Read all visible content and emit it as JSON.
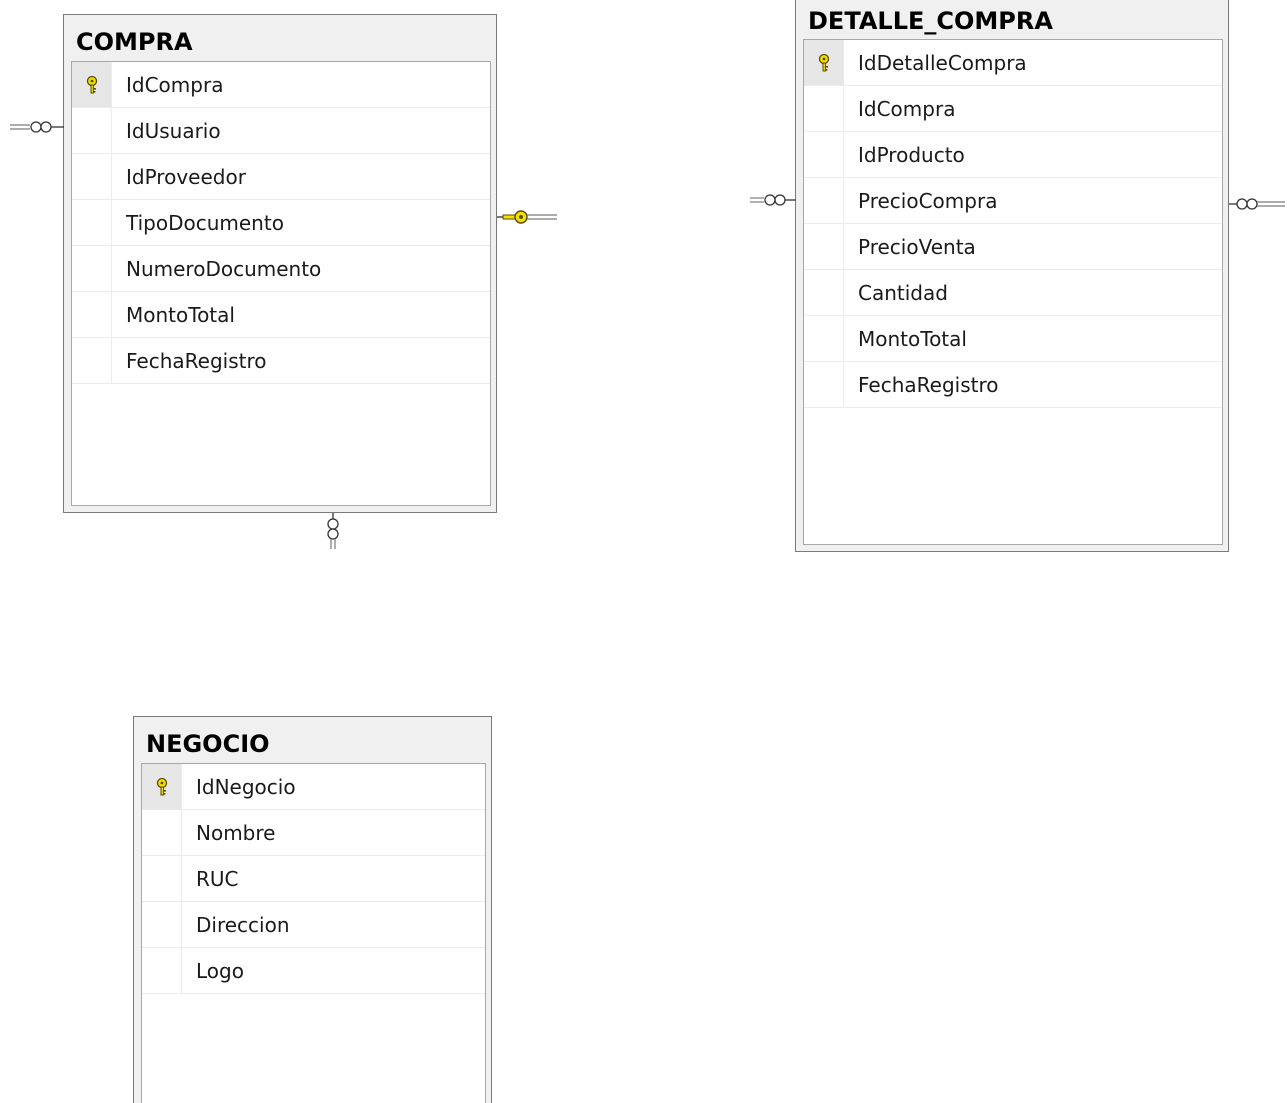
{
  "tables": [
    {
      "name": "COMPRA",
      "columns": [
        {
          "label": "IdCompra",
          "pk": true
        },
        {
          "label": "IdUsuario",
          "pk": false
        },
        {
          "label": "IdProveedor",
          "pk": false
        },
        {
          "label": "TipoDocumento",
          "pk": false
        },
        {
          "label": "NumeroDocumento",
          "pk": false
        },
        {
          "label": "MontoTotal",
          "pk": false
        },
        {
          "label": "FechaRegistro",
          "pk": false
        }
      ]
    },
    {
      "name": "DETALLE_COMPRA",
      "columns": [
        {
          "label": "IdDetalleCompra",
          "pk": true
        },
        {
          "label": "IdCompra",
          "pk": false
        },
        {
          "label": "IdProducto",
          "pk": false
        },
        {
          "label": "PrecioCompra",
          "pk": false
        },
        {
          "label": "PrecioVenta",
          "pk": false
        },
        {
          "label": "Cantidad",
          "pk": false
        },
        {
          "label": "MontoTotal",
          "pk": false
        },
        {
          "label": "FechaRegistro",
          "pk": false
        }
      ]
    },
    {
      "name": "NEGOCIO",
      "columns": [
        {
          "label": "IdNegocio",
          "pk": true
        },
        {
          "label": "Nombre",
          "pk": false
        },
        {
          "label": "RUC",
          "pk": false
        },
        {
          "label": "Direccion",
          "pk": false
        },
        {
          "label": "Logo",
          "pk": false
        }
      ]
    }
  ],
  "colors": {
    "key_fill": "#f5e100",
    "key_stroke": "#5a4a00",
    "line": "#7a7a7a"
  },
  "icons": {
    "primary_key": "key-icon",
    "many_end": "infinity-icon",
    "one_end": "key-icon"
  }
}
